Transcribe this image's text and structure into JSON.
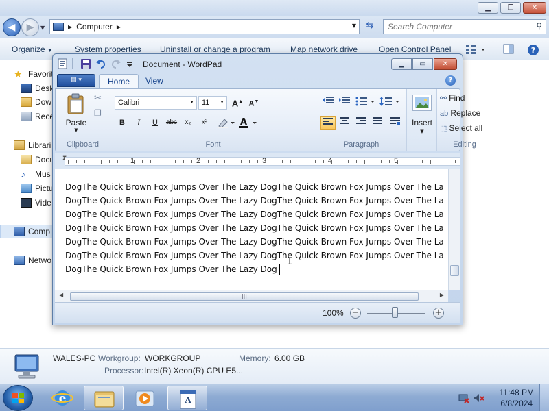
{
  "explorer": {
    "breadcrumb": "Computer",
    "search_placeholder": "Search Computer",
    "commands": {
      "organize": "Organize",
      "system_properties": "System properties",
      "uninstall": "Uninstall or change a program",
      "map_drive": "Map network drive",
      "control_panel": "Open Control Panel"
    },
    "nav": {
      "favorites": "Favorit",
      "desktop": "Desk",
      "downloads": "Dow",
      "recent": "Rece",
      "libraries": "Librari",
      "documents": "Docu",
      "music": "Mus",
      "pictures": "Pictu",
      "videos": "Vide",
      "computer": "Comp",
      "network": "Netwo"
    },
    "details": {
      "pc_name": "WALES-PC",
      "workgroup_label": "Workgroup:",
      "workgroup_value": "WORKGROUP",
      "memory_label": "Memory:",
      "memory_value": "6.00 GB",
      "processor_label": "Processor:",
      "processor_value": "Intel(R) Xeon(R) CPU E5..."
    }
  },
  "wordpad": {
    "title": "Document - WordPad",
    "tabs": {
      "home": "Home",
      "view": "View"
    },
    "ribbon": {
      "clipboard": {
        "label": "Clipboard",
        "paste": "Paste"
      },
      "font": {
        "label": "Font",
        "family": "Calibri",
        "size": "11",
        "bold": "B",
        "italic": "I",
        "underline": "U",
        "strike": "abc",
        "subscript": "x₂",
        "superscript": "x²"
      },
      "paragraph": {
        "label": "Paragraph"
      },
      "insert": {
        "label": "Insert"
      },
      "editing": {
        "label": "Editing",
        "find": "Find",
        "replace": "Replace",
        "select_all": "Select all"
      }
    },
    "ruler_numbers": [
      "1",
      "2",
      "3",
      "4",
      "5"
    ],
    "document_lines": [
      "DogThe Quick Brown Fox Jumps Over The Lazy DogThe Quick Brown Fox Jumps Over The La",
      "DogThe Quick Brown Fox Jumps Over The Lazy DogThe Quick Brown Fox Jumps Over The La",
      "DogThe Quick Brown Fox Jumps Over The Lazy DogThe Quick Brown Fox Jumps Over The La",
      "DogThe Quick Brown Fox Jumps Over The Lazy DogThe Quick Brown Fox Jumps Over The La",
      "DogThe Quick Brown Fox Jumps Over The Lazy DogThe Quick Brown Fox Jumps Over The La",
      "DogThe Quick Brown Fox Jumps Over The Lazy DogThe Quick Brown Fox Jumps Over The La",
      "DogThe Quick Brown Fox Jumps Over The Lazy Dog"
    ],
    "zoom": "100%"
  },
  "taskbar": {
    "time": "11:48 PM",
    "date": "6/8/2024"
  },
  "colors": {
    "accent": "#1f4e9c",
    "selection": "#f9c55a",
    "taskbar": "#8eabd3"
  }
}
